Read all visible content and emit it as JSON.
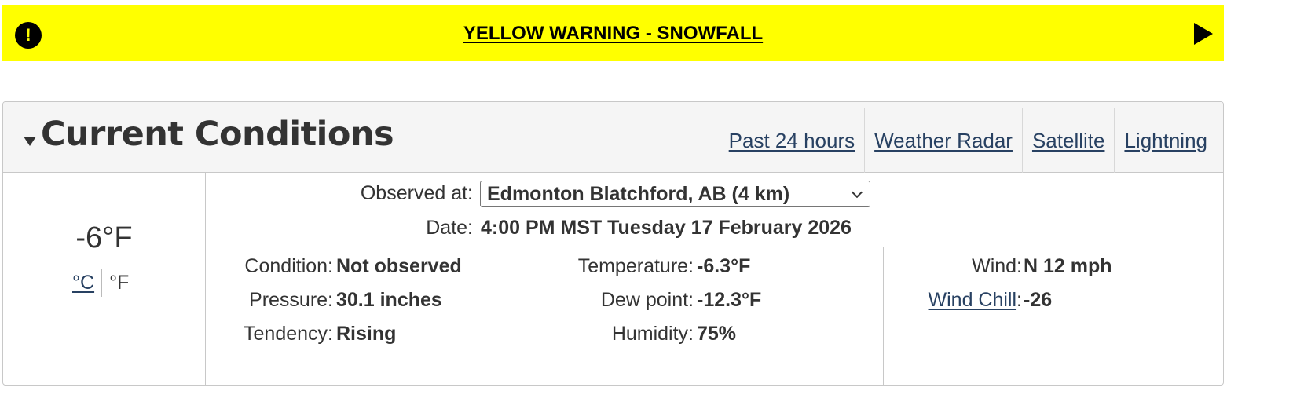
{
  "warning": {
    "title": "YELLOW WARNING - SNOWFALL",
    "icon": "exclamation-circle-icon",
    "color": "#ffff00"
  },
  "panel": {
    "title": "Current Conditions",
    "links": [
      "Past 24 hours",
      "Weather Radar",
      "Satellite",
      "Lightning"
    ]
  },
  "current": {
    "temperature": "-6°F",
    "unit_c": "°C",
    "unit_f": "°F"
  },
  "observation": {
    "observed_label": "Observed at:",
    "station": "Edmonton Blatchford, AB (4 km)",
    "date_label": "Date:",
    "date": "4:00 PM MST Tuesday 17 February 2026"
  },
  "details": {
    "col1": [
      {
        "label": "Condition:",
        "value": "Not observed"
      },
      {
        "label": "Pressure:",
        "value": "30.1 inches"
      },
      {
        "label": "Tendency:",
        "value": "Rising"
      }
    ],
    "col2": [
      {
        "label": "Temperature:",
        "value": "-6.3°F"
      },
      {
        "label": "Dew point:",
        "value": "-12.3°F"
      },
      {
        "label": "Humidity:",
        "value": "75%"
      }
    ],
    "col3": [
      {
        "label": "Wind:",
        "value": "N 12 mph"
      },
      {
        "label": "Wind Chill",
        "suffix": ":",
        "value": "-26"
      }
    ]
  },
  "colors": {
    "link": "#284162",
    "text": "#333333",
    "header_bg": "#f5f5f5"
  }
}
